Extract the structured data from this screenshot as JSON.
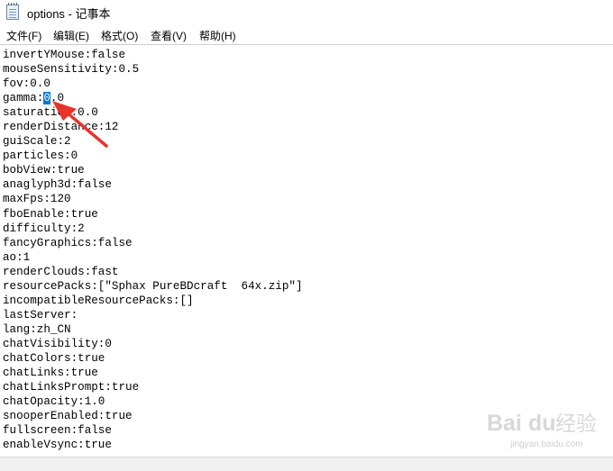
{
  "window": {
    "title": "options - 记事本"
  },
  "menu": [
    "文件(F)",
    "编辑(E)",
    "格式(O)",
    "查看(V)",
    "帮助(H)"
  ],
  "lines": [
    "invertYMouse:false",
    "mouseSensitivity:0.5",
    "fov:0.0",
    "gamma:|0|.0",
    "saturation:0.0",
    "renderDistance:12",
    "guiScale:2",
    "particles:0",
    "bobView:true",
    "anaglyph3d:false",
    "maxFps:120",
    "fboEnable:true",
    "difficulty:2",
    "fancyGraphics:false",
    "ao:1",
    "renderClouds:fast",
    "resourcePacks:[\"Sphax PureBDcraft  64x.zip\"]",
    "incompatibleResourcePacks:[]",
    "lastServer:",
    "lang:zh_CN",
    "chatVisibility:0",
    "chatColors:true",
    "chatLinks:true",
    "chatLinksPrompt:true",
    "chatOpacity:1.0",
    "snooperEnabled:true",
    "fullscreen:false",
    "enableVsync:true"
  ],
  "watermark": {
    "brand": "Baidu 经验",
    "url": "jingyan.baidu.com"
  },
  "colors": {
    "selection": "#0078d7",
    "arrow": "#e8332a"
  }
}
